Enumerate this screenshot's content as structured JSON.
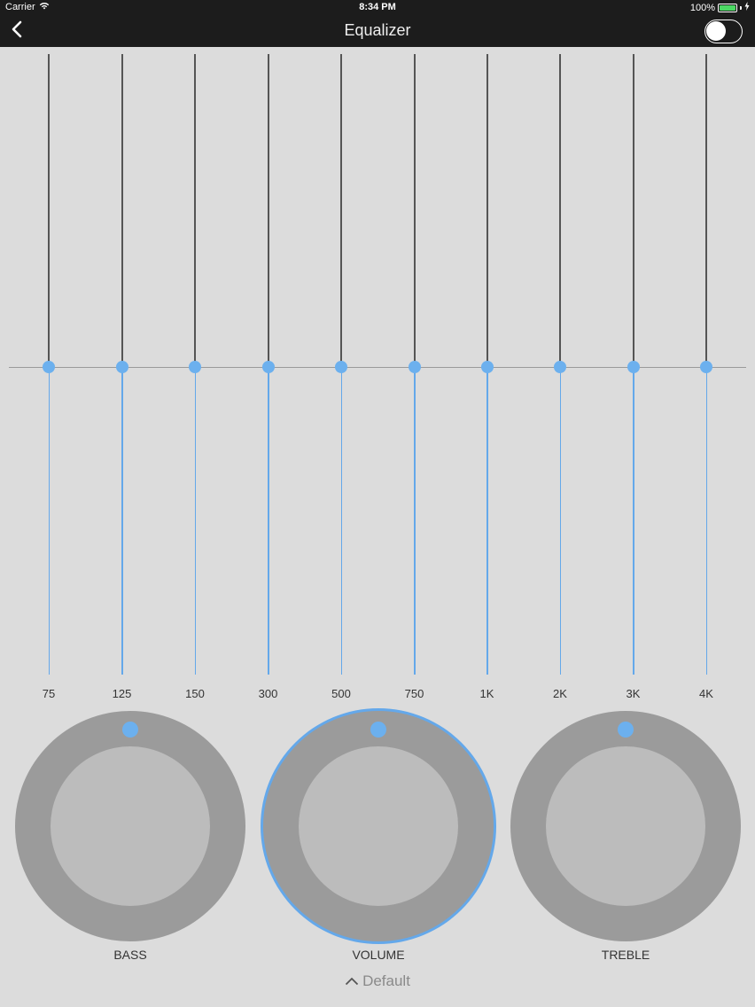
{
  "status": {
    "carrier": "Carrier",
    "time": "8:34 PM",
    "battery": "100%"
  },
  "nav": {
    "title": "Equalizer",
    "toggle_on": false
  },
  "bands": [
    {
      "label": "75",
      "gain": 0
    },
    {
      "label": "125",
      "gain": 0
    },
    {
      "label": "150",
      "gain": 0
    },
    {
      "label": "300",
      "gain": 0
    },
    {
      "label": "500",
      "gain": 0
    },
    {
      "label": "750",
      "gain": 0
    },
    {
      "label": "1K",
      "gain": 0
    },
    {
      "label": "2K",
      "gain": 0
    },
    {
      "label": "3K",
      "gain": 0
    },
    {
      "label": "4K",
      "gain": 0
    }
  ],
  "knobs": [
    {
      "label": "BASS",
      "active": false
    },
    {
      "label": "VOLUME",
      "active": true
    },
    {
      "label": "TREBLE",
      "active": false
    }
  ],
  "default_label": "Default",
  "colors": {
    "accent": "#6cb0ee",
    "nav_background": "#1c1c1c",
    "background": "#dcdcdc"
  }
}
